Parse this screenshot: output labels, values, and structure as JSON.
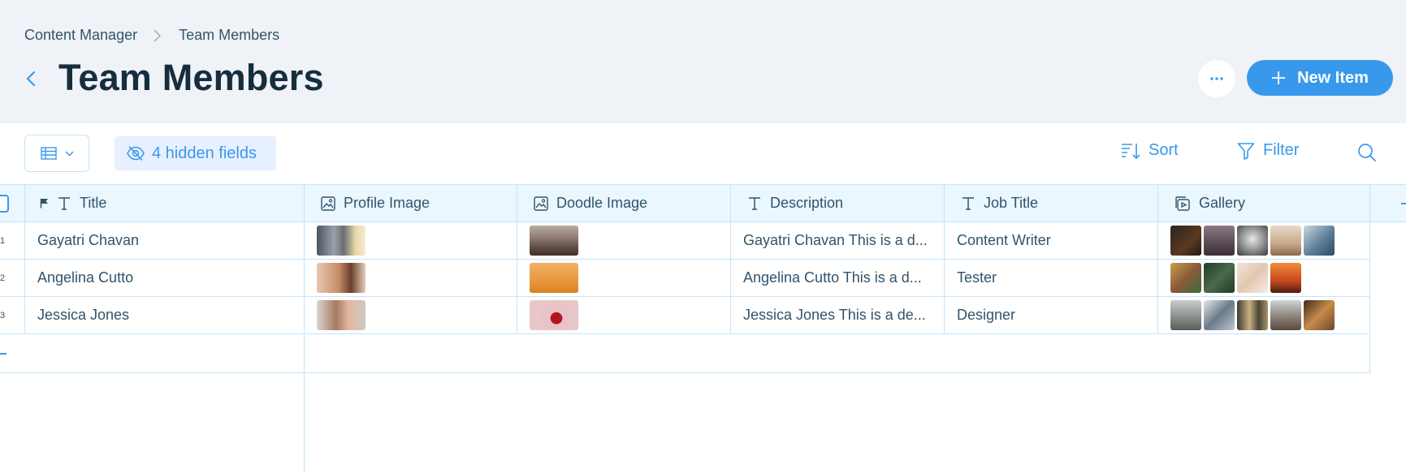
{
  "breadcrumb": {
    "parent": "Content Manager",
    "current": "Team Members"
  },
  "page": {
    "title": "Team Members"
  },
  "actions": {
    "new_item_label": "New Item"
  },
  "toolbar": {
    "hidden_fields_label": "4 hidden fields",
    "sort_label": "Sort",
    "filter_label": "Filter"
  },
  "table": {
    "columns": [
      "Title",
      "Profile Image",
      "Doodle Image",
      "Description",
      "Job Title",
      "Gallery"
    ],
    "rows": [
      {
        "num": "1",
        "title": "Gayatri Chavan",
        "description": "Gayatri Chavan This is a d...",
        "job": "Content Writer"
      },
      {
        "num": "2",
        "title": "Angelina Cutto",
        "description": "Angelina Cutto This is a d...",
        "job": "Tester"
      },
      {
        "num": "3",
        "title": "Jessica Jones",
        "description": "Jessica Jones This is a de...",
        "job": "Designer"
      }
    ]
  },
  "colors": {
    "accent": "#3899ec",
    "header_bg": "#eff2f6",
    "title": "#162d3d",
    "grid_line": "#c1e4fe",
    "hidden_bg": "#e7f0ff"
  }
}
